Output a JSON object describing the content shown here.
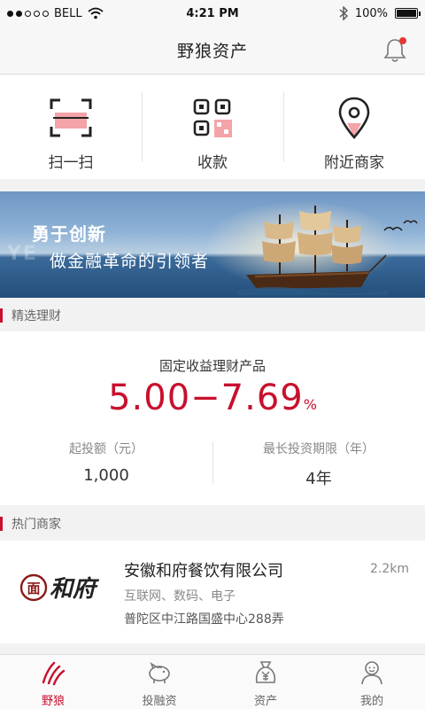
{
  "status_bar": {
    "carrier": "BELL",
    "time": "4:21 PM",
    "battery": "100%",
    "battery_level": 1.0
  },
  "nav": {
    "title": "野狼资产"
  },
  "quick_actions": [
    {
      "label": "扫一扫",
      "icon": "scan-icon"
    },
    {
      "label": "收款",
      "icon": "qr-code-icon"
    },
    {
      "label": "附近商家",
      "icon": "location-pin-icon"
    }
  ],
  "banner": {
    "title": "勇于创新",
    "subtitle": "做金融革命的引领者",
    "watermark": "YE"
  },
  "featured": {
    "section_title": "精选理财",
    "product_name": "固定收益理财产品",
    "rate_range": "5.00−7.69",
    "rate_unit": "%",
    "min_invest_label": "起投额（元）",
    "min_invest_value": "1,000",
    "max_term_label": "最长投资期限（年）",
    "max_term_value": "4年"
  },
  "merchants": {
    "section_title": "热门商家",
    "items": [
      {
        "name": "安徽和府餐饮有限公司",
        "distance": "2.2km",
        "tags": "互联网、数码、电子",
        "address": "普陀区中江路国盛中心288弄",
        "logo_text": "和府",
        "logo_seal": "面"
      }
    ]
  },
  "tabs": [
    {
      "label": "野狼",
      "icon": "wolf-claw-icon",
      "active": true
    },
    {
      "label": "投融资",
      "icon": "piggy-bank-icon",
      "active": false
    },
    {
      "label": "资产",
      "icon": "money-bag-icon",
      "active": false
    },
    {
      "label": "我的",
      "icon": "user-icon",
      "active": false
    }
  ],
  "colors": {
    "accent": "#c8102e",
    "scan_fill": "#f4a3a8",
    "text_primary": "#333333",
    "text_secondary": "#888888"
  }
}
